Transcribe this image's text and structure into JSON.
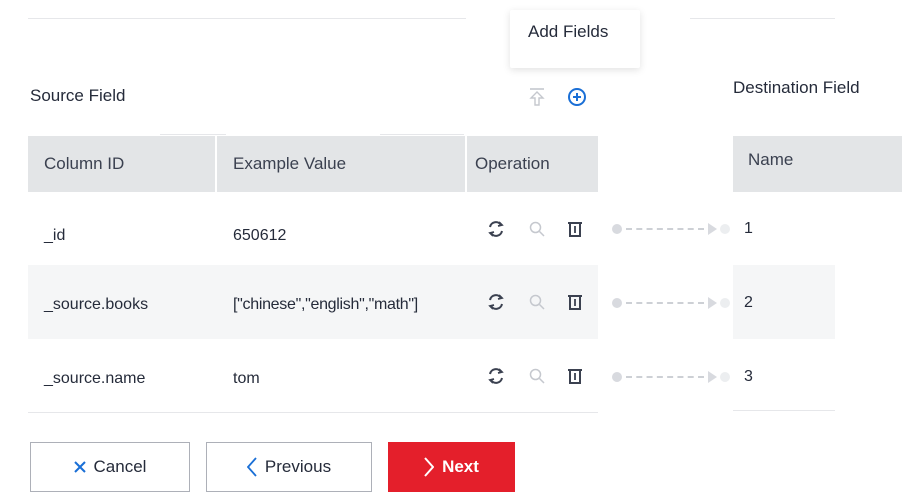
{
  "tooltip": {
    "text": "Add Fields"
  },
  "source": {
    "title": "Source Field",
    "columns": [
      "Column ID",
      "Example Value",
      "Operation"
    ],
    "rows": [
      {
        "column_id": "_id",
        "example_value": "650612"
      },
      {
        "column_id": "_source.books",
        "example_value": "[\"chinese\",\"english\",\"math\"]"
      },
      {
        "column_id": "_source.name",
        "example_value": "tom"
      }
    ]
  },
  "destination": {
    "title": "Destination Field",
    "columns": [
      "Name"
    ],
    "rows": [
      "1",
      "2",
      "3"
    ]
  },
  "buttons": {
    "cancel": "Cancel",
    "previous": "Previous",
    "next": "Next"
  },
  "colors": {
    "primary": "#e41f2b",
    "accent_blue": "#1a6fd6",
    "header_bg": "#e3e5e7",
    "row_alt_bg": "#f5f6f7"
  },
  "icons": {
    "add_fields": "plus-circle-icon",
    "move_top": "move-to-top-icon",
    "row_operations": [
      "refresh-icon",
      "search-icon",
      "trash-icon"
    ]
  }
}
